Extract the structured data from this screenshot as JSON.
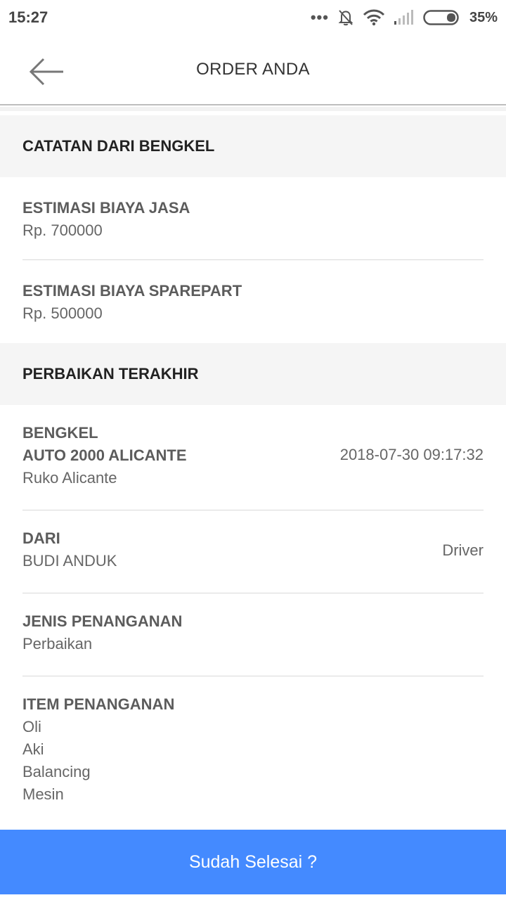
{
  "status": {
    "time": "15:27",
    "battery": "35%"
  },
  "header": {
    "title": "ORDER ANDA"
  },
  "catatan": {
    "section_title": "CATATAN DARI BENGKEL",
    "items": [
      {
        "label": "ESTIMASI BIAYA JASA",
        "value": "Rp. 700000"
      },
      {
        "label": "ESTIMASI BIAYA SPAREPART",
        "value": "Rp. 500000"
      }
    ]
  },
  "perbaikan": {
    "section_title": "PERBAIKAN TERAKHIR",
    "bengkel": {
      "label": "BENGKEL",
      "name": "AUTO 2000 ALICANTE",
      "address": "Ruko Alicante",
      "datetime": "2018-07-30 09:17:32"
    },
    "dari": {
      "label": "DARI",
      "value": "BUDI ANDUK",
      "role": "Driver"
    },
    "jenis": {
      "label": "JENIS PENANGANAN",
      "value": "Perbaikan"
    },
    "item": {
      "label": "ITEM PENANGANAN",
      "values": [
        "Oli",
        "Aki",
        "Balancing",
        "Mesin"
      ]
    }
  },
  "footer": {
    "button_label": "Sudah Selesai ?"
  },
  "colors": {
    "accent": "#448aff",
    "section_bg": "#f5f5f5"
  }
}
